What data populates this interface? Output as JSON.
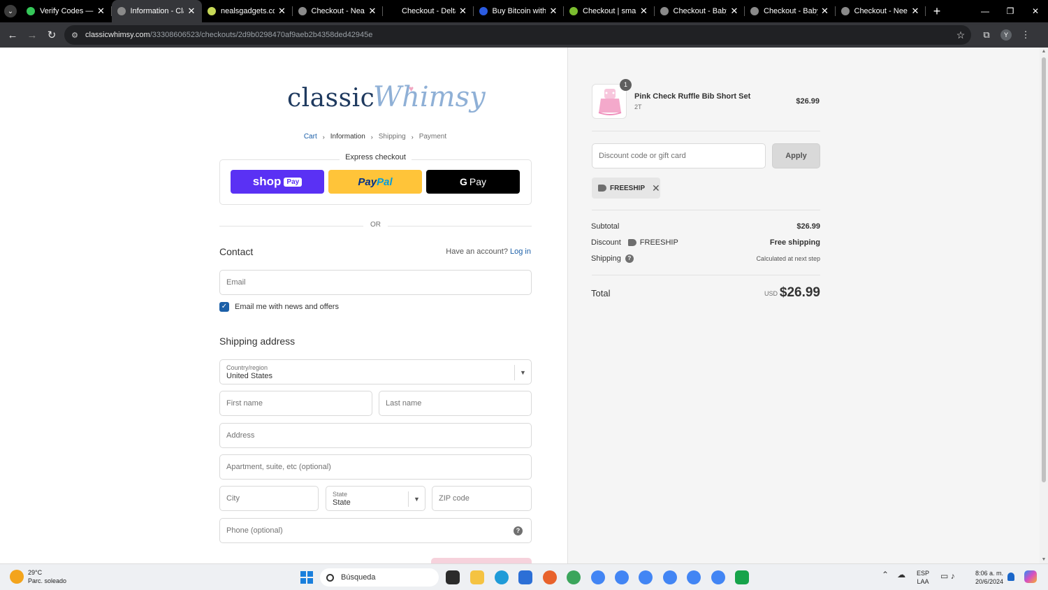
{
  "browser": {
    "tabs": [
      {
        "title": "Verify Codes — Si",
        "favicon_color": "#35c759",
        "active": false
      },
      {
        "title": "Information - Clas",
        "favicon_color": "#8a8a8a",
        "active": true
      },
      {
        "title": "nealsgadgets.com",
        "favicon_color": "#c7d957",
        "active": false
      },
      {
        "title": "Checkout - Neals",
        "favicon_color": "#8a8a8a",
        "active": false
      },
      {
        "title": "Checkout - Delta",
        "favicon_color": "#000000",
        "active": false
      },
      {
        "title": "Buy Bitcoin with C",
        "favicon_color": "#2b5be0",
        "active": false
      },
      {
        "title": "Checkout | small-",
        "favicon_color": "#7bbd2f",
        "active": false
      },
      {
        "title": "Checkout - BabyR",
        "favicon_color": "#8a8a8a",
        "active": false
      },
      {
        "title": "Checkout - BabyR",
        "favicon_color": "#8a8a8a",
        "active": false
      },
      {
        "title": "Checkout - Neem",
        "favicon_color": "#8a8a8a",
        "active": false
      }
    ],
    "url_host": "classicwhimsy.com",
    "url_path": "/33308606523/checkouts/2d9b0298470af9aeb2b4358ded42945e",
    "profile_initial": "Y"
  },
  "store": {
    "logo_primary": "classic",
    "logo_secondary": "Whimsy"
  },
  "breadcrumb": {
    "items": [
      "Cart",
      "Information",
      "Shipping",
      "Payment"
    ]
  },
  "express": {
    "title": "Express checkout",
    "shop_label": "shop",
    "shop_badge": "Pay",
    "paypal_part1": "Pay",
    "paypal_part2": "Pal",
    "gpay_g": "G",
    "gpay_label": "Pay",
    "or_label": "OR"
  },
  "contact": {
    "heading": "Contact",
    "have_account": "Have an account?",
    "login_link": "Log in",
    "email_placeholder": "Email",
    "newsletter_label": "Email me with news and offers",
    "newsletter_checked": true
  },
  "shipping": {
    "heading": "Shipping address",
    "country_label": "Country/region",
    "country_value": "United States",
    "first_name": "First name",
    "last_name": "Last name",
    "address": "Address",
    "apartment": "Apartment, suite, etc (optional)",
    "city": "City",
    "state_label": "State",
    "state_value": "State",
    "zip": "ZIP code",
    "phone": "Phone (optional)"
  },
  "summary": {
    "product_name": "Pink Check Ruffle Bib Short Set",
    "product_variant": "2T",
    "product_quantity": "1",
    "product_price": "$26.99",
    "discount_placeholder": "Discount code or gift card",
    "apply_label": "Apply",
    "applied_code": "FREESHIP",
    "subtotal_label": "Subtotal",
    "subtotal_value": "$26.99",
    "discount_label": "Discount",
    "discount_code": "FREESHIP",
    "discount_value": "Free shipping",
    "shipping_label": "Shipping",
    "shipping_value": "Calculated at next step",
    "total_label": "Total",
    "total_currency": "USD",
    "total_value": "$26.99"
  },
  "taskbar": {
    "temperature": "29°C",
    "weather": "Parc. soleado",
    "search_placeholder": "Búsqueda",
    "lang_top": "ESP",
    "lang_bottom": "LAA",
    "time": "8:06 a. m.",
    "date": "20/6/2024"
  },
  "colors": {
    "accent": "#1b5fa8",
    "shop_pay": "#5a31f4",
    "paypal": "#ffc439",
    "summary_bg": "#f5f5f5"
  }
}
